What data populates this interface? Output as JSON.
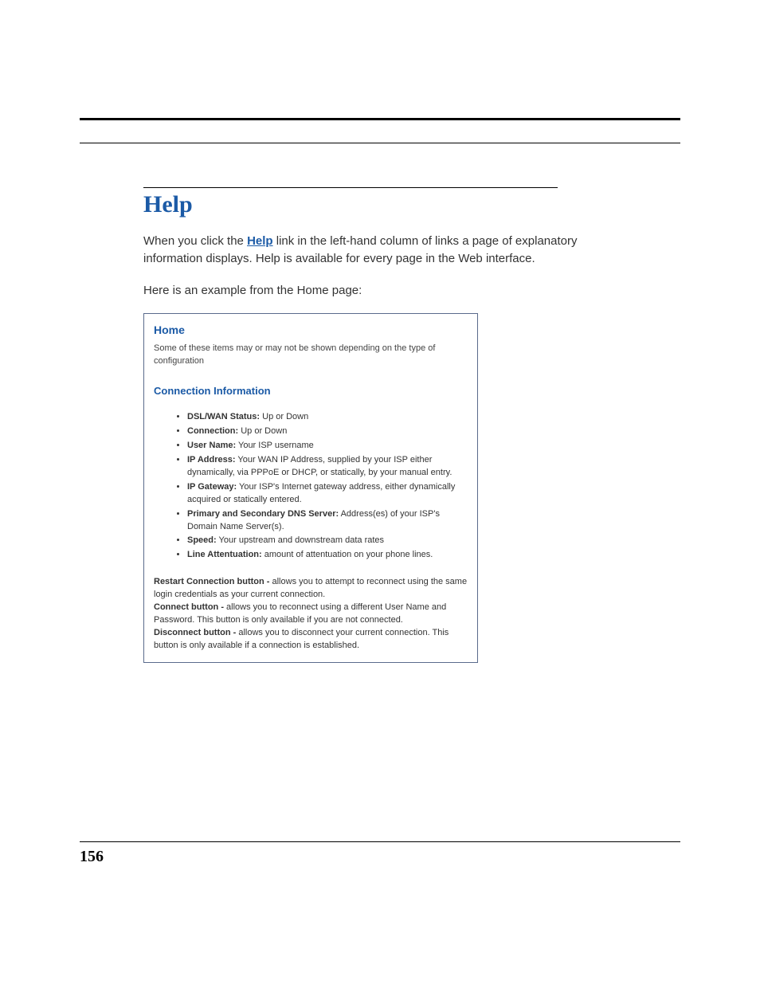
{
  "page_number": "156",
  "section_title": "Help",
  "intro_before_link": "When you click the ",
  "help_link_text": "Help",
  "intro_after_link": " link in the left-hand column of links a page of explanatory information displays. Help is available for every page in the Web interface.",
  "example_lead": "Here is an example from the Home page:",
  "panel": {
    "title": "Home",
    "intro": "Some of these items may or may not be shown depending on the type of configuration",
    "subsection_title": "Connection Information",
    "items": [
      {
        "label": "DSL/WAN Status:",
        "desc": " Up or Down"
      },
      {
        "label": "Connection:",
        "desc": " Up or Down"
      },
      {
        "label": "User Name:",
        "desc": " Your ISP username"
      },
      {
        "label": "IP Address:",
        "desc": " Your WAN IP Address, supplied by your ISP either dynamically, via PPPoE or DHCP, or statically, by your manual entry."
      },
      {
        "label": "IP Gateway:",
        "desc": " Your ISP's Internet gateway address, either dynamically acquired or statically entered."
      },
      {
        "label": "Primary and Secondary DNS Server:",
        "desc": " Address(es) of your ISP's Domain Name Server(s)."
      },
      {
        "label": "Speed:",
        "desc": " Your upstream and downstream data rates"
      },
      {
        "label": "Line Attentuation:",
        "desc": " amount of attentuation on your phone lines."
      }
    ],
    "buttons": [
      {
        "label": "Restart Connection button - ",
        "desc": "allows you to attempt to reconnect using the same login credentials as your current connection."
      },
      {
        "label": "Connect button - ",
        "desc": "allows you to reconnect using a different User Name and Password. This button is only available if you are not connected."
      },
      {
        "label": "Disconnect button - ",
        "desc": "allows you to disconnect your current connection. This button is only available if a connection is established."
      }
    ]
  }
}
